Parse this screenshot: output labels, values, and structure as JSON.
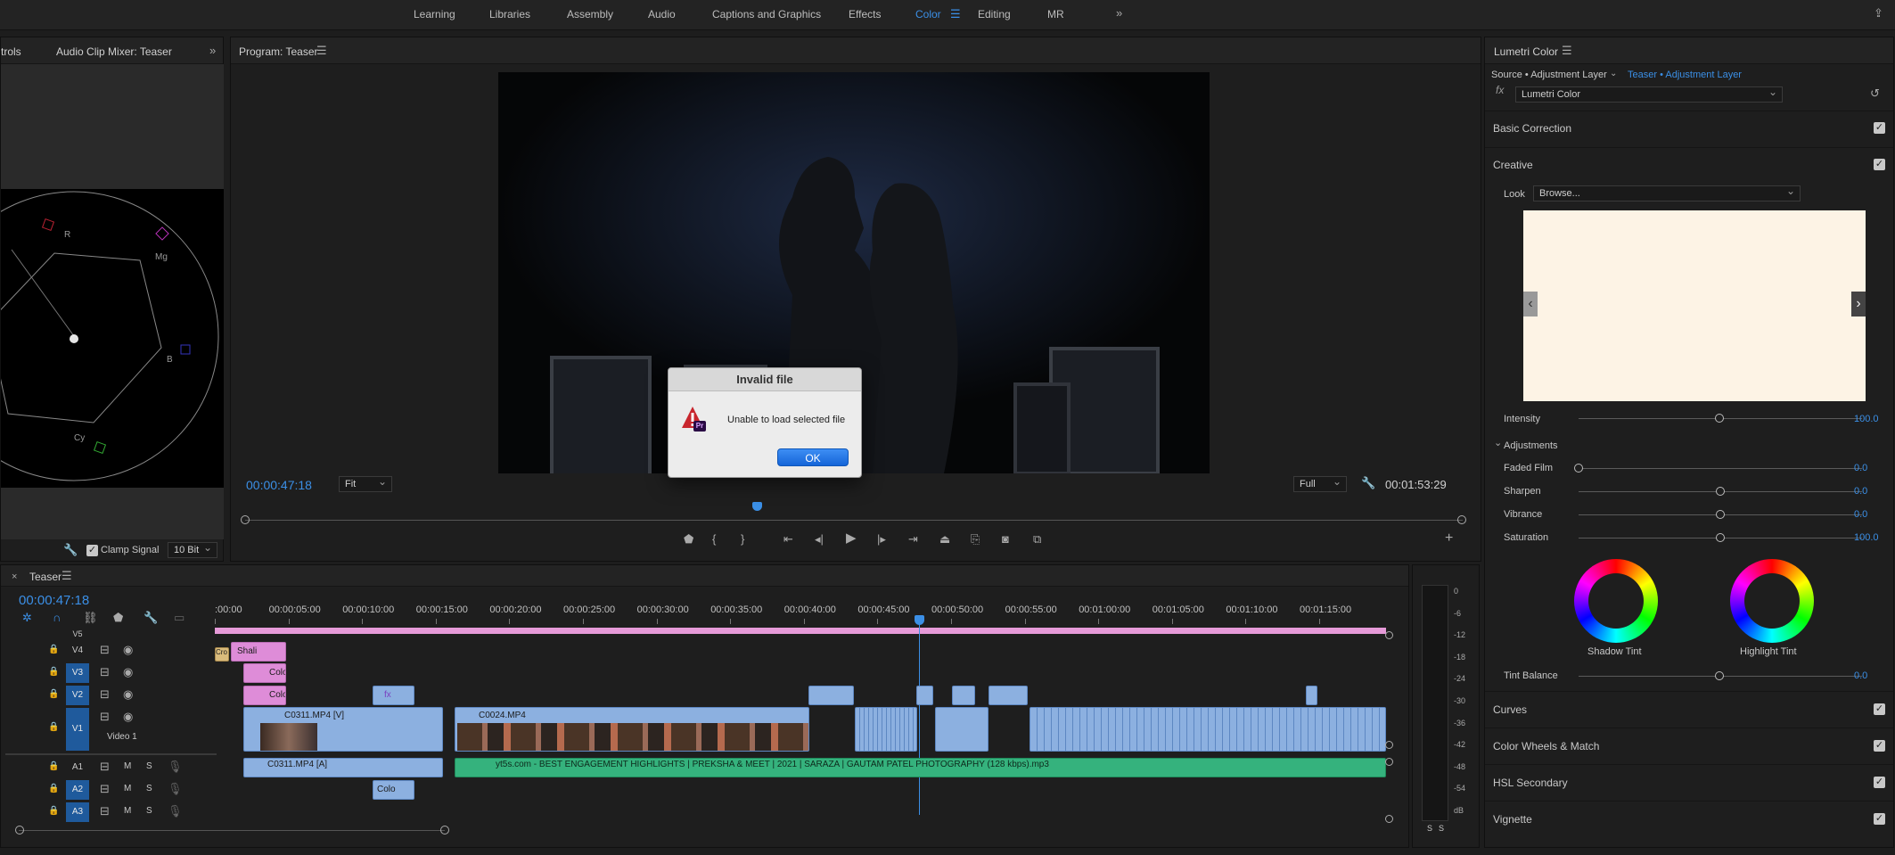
{
  "workspaces": {
    "tabs": [
      "Learning",
      "Libraries",
      "Assembly",
      "Audio",
      "Captions and Graphics",
      "Effects",
      "Color",
      "Editing",
      "MR"
    ],
    "active": "Color"
  },
  "left_panel": {
    "tab1": "trols",
    "tab2": "Audio Clip Mixer: Teaser",
    "scope_labels": {
      "r": "R",
      "mg": "Mg",
      "b": "B",
      "cy": "Cy"
    },
    "clamp_signal": "Clamp Signal",
    "bit_depth": "10 Bit"
  },
  "program": {
    "title": "Program: Teaser",
    "timecode_in": "00:00:47:18",
    "fit": "Fit",
    "quality": "Full",
    "duration": "00:01:53:29",
    "playhead_fraction": 0.42
  },
  "dialog": {
    "title": "Invalid file",
    "message": "Unable to load selected file",
    "ok": "OK",
    "badge": "Pr"
  },
  "lumetri": {
    "title": "Lumetri Color",
    "source": "Source • Adjustment Layer",
    "target": "Teaser • Adjustment Layer",
    "fx_label": "fx",
    "effect": "Lumetri Color",
    "basic_correction": "Basic Correction",
    "creative": "Creative",
    "look_label": "Look",
    "look_value": "Browse...",
    "intensity_label": "Intensity",
    "intensity": "100.0",
    "adjustments": "Adjustments",
    "sliders": [
      {
        "label": "Faded Film",
        "value": "0.0",
        "pos": 0.0
      },
      {
        "label": "Sharpen",
        "value": "0.0",
        "pos": 0.5
      },
      {
        "label": "Vibrance",
        "value": "0.0",
        "pos": 0.5
      },
      {
        "label": "Saturation",
        "value": "100.0",
        "pos": 0.5
      }
    ],
    "shadow_tint": "Shadow Tint",
    "highlight_tint": "Highlight Tint",
    "tint_balance_label": "Tint Balance",
    "tint_balance": "0.0",
    "sections": [
      "Curves",
      "Color Wheels & Match",
      "HSL Secondary",
      "Vignette"
    ]
  },
  "timeline": {
    "title": "Teaser",
    "timecode": "00:00:47:18",
    "ruler": [
      ":00:00",
      "00:00:05:00",
      "00:00:10:00",
      "00:00:15:00",
      "00:00:20:00",
      "00:00:25:00",
      "00:00:30:00",
      "00:00:35:00",
      "00:00:40:00",
      "00:00:45:00",
      "00:00:50:00",
      "00:00:55:00",
      "00:01:00:00",
      "00:01:05:00",
      "00:01:10:00",
      "00:01:15:00"
    ],
    "tracks_video": [
      "V5",
      "V4",
      "V3",
      "V2",
      "V1"
    ],
    "video1_name": "Video 1",
    "tracks_audio": [
      "A1",
      "A2",
      "A3"
    ],
    "track_buttons": {
      "mute": "M",
      "solo": "S"
    },
    "clips": {
      "v1a": "C0311.MP4 [V]",
      "v1b": "C0024.MP4",
      "a1a": "C0311.MP4 [A]",
      "a1b": "yt5s.com - BEST ENGAGEMENT HIGHLIGHTS | PREKSHA & MEET | 2021 | SARAZA | GAUTAM PATEL PHOTOGRAPHY (128 kbps).mp3",
      "v4": "Shali",
      "v3": "Colo",
      "v2": "Colo",
      "cross": "Cro",
      "fx": "fx",
      "col": "Colo"
    }
  },
  "meter": {
    "scale": [
      "0",
      "-6",
      "-12",
      "-18",
      "-24",
      "-30",
      "-36",
      "-42",
      "-48",
      "-54",
      "dB"
    ],
    "solo": [
      "S",
      "S"
    ]
  }
}
